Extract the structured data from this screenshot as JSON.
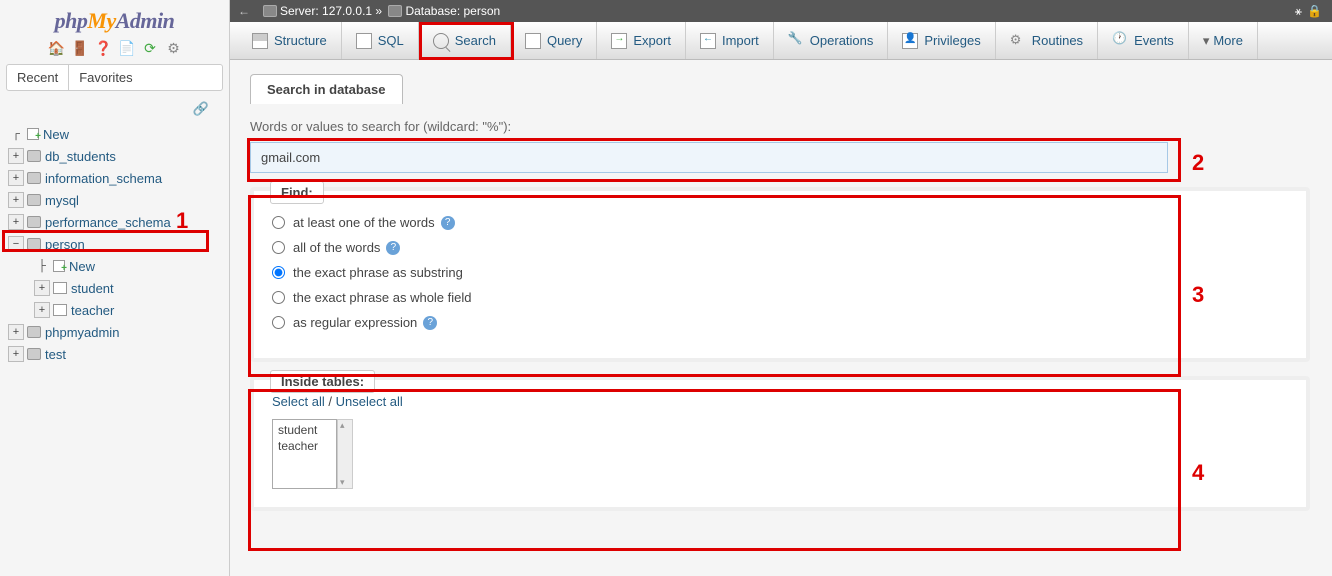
{
  "logo": {
    "part1": "php",
    "part2": "My",
    "part3": "Admin"
  },
  "sidebar_tabs": {
    "recent": "Recent",
    "favorites": "Favorites"
  },
  "tree": {
    "new": "New",
    "items": [
      "db_students",
      "information_schema",
      "mysql",
      "performance_schema",
      "person",
      "phpmyadmin",
      "test"
    ],
    "person_children": {
      "new": "New",
      "tables": [
        "student",
        "teacher"
      ]
    }
  },
  "topbar": {
    "server_label": "Server:",
    "server_value": "127.0.0.1",
    "sep": "»",
    "db_label": "Database:",
    "db_value": "person"
  },
  "tabs": [
    "Structure",
    "SQL",
    "Search",
    "Query",
    "Export",
    "Import",
    "Operations",
    "Privileges",
    "Routines",
    "Events",
    "More"
  ],
  "panel": {
    "title": "Search in database",
    "words_label": "Words or values to search for (wildcard: \"%\"):",
    "search_value": "gmail.com",
    "find_legend": "Find:",
    "find_options": [
      "at least one of the words",
      "all of the words",
      "the exact phrase as substring",
      "the exact phrase as whole field",
      "as regular expression"
    ],
    "inside_legend": "Inside tables:",
    "select_all": "Select all",
    "unselect_all": "Unselect all",
    "tables": [
      "student",
      "teacher"
    ]
  },
  "annotations": [
    "1",
    "2",
    "3",
    "4"
  ]
}
